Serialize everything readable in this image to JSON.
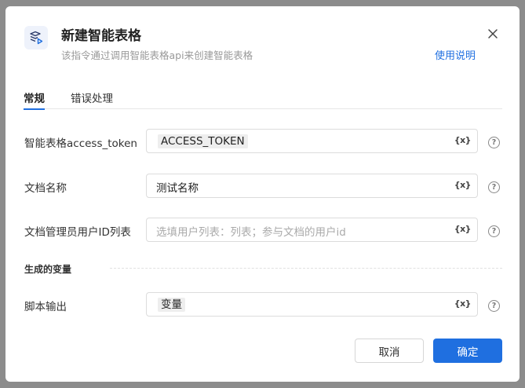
{
  "dialog": {
    "title": "新建智能表格",
    "subtitle": "该指令通过调用智能表格api来创建智能表格",
    "help_link": "使用说明",
    "icon": "smart-sheet-icon"
  },
  "tabs": [
    {
      "label": "常规",
      "active": true
    },
    {
      "label": "错误处理",
      "active": false
    }
  ],
  "fields": {
    "access_token": {
      "label": "智能表格access_token",
      "value": "ACCESS_TOKEN"
    },
    "doc_name": {
      "label": "文档名称",
      "value": "测试名称"
    },
    "admin_ids": {
      "label": "文档管理员用户ID列表",
      "placeholder": "选填用户列表：列表；参与文档的用户id"
    }
  },
  "output_section": {
    "title": "生成的变量",
    "script_output": {
      "label": "脚本输出",
      "value": "变量"
    }
  },
  "var_button_label": "{x}",
  "help_glyph": "?",
  "buttons": {
    "cancel": "取消",
    "ok": "确定"
  },
  "colors": {
    "accent": "#1f6fe0",
    "overlay": "#8c8c8c"
  }
}
